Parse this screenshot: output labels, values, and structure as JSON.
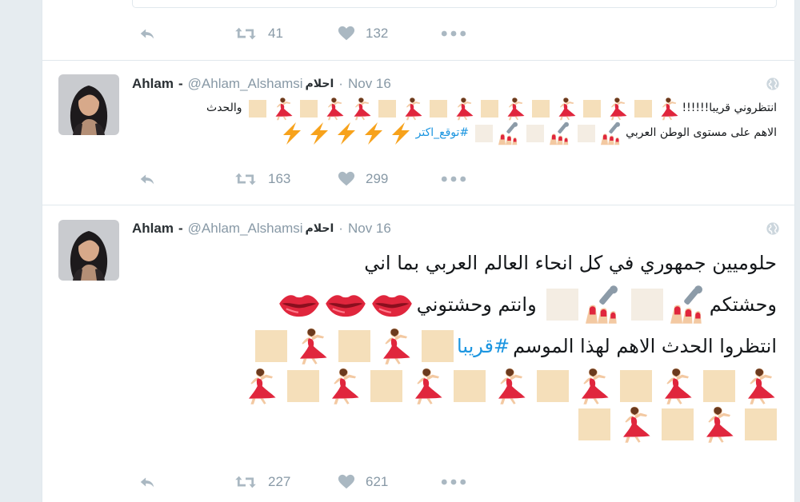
{
  "colors": {
    "accent": "#1b95e0",
    "muted": "#8899a6",
    "icon": "#aab8c2",
    "border": "#e1e8ed",
    "dancer": "#e0263d",
    "bolt": "#f7a21b",
    "square": "#f5dfba"
  },
  "top_actions": {
    "retweets": "41",
    "likes": "132"
  },
  "tweets": [
    {
      "name": "Ahlam",
      "sep": "-",
      "handle": "@Ahlam_Alshamsi",
      "arabic_name": "احلام",
      "dot": "·",
      "time": "Nov 16",
      "line1_text": "انتظروني قريبا!!!!!!",
      "line1_end": "والحدث",
      "line2_text": "الاهم على مستوى الوطن العربي",
      "hashtag": "#توقع_اكتر",
      "retweets": "163",
      "likes": "299"
    },
    {
      "name": "Ahlam",
      "sep": "-",
      "handle": "@Ahlam_Alshamsi",
      "arabic_name": "احلام",
      "dot": "·",
      "time": "Nov 16",
      "line1_text": "حلوميين جمهوري في كل انحاء العالم العربي بما اني",
      "line2_text_a": "وحشتكم",
      "line2_text_b": "وانتم وحشتوني",
      "line3_text": "انتظروا الحدث الاهم لهذا الموسم",
      "hashtag": "#قريبا",
      "retweets": "227",
      "likes": "621"
    }
  ],
  "icons": [
    "reply-icon",
    "retweet-icon",
    "heart-icon",
    "more-icon",
    "globe-icon",
    "dancer-icon",
    "nail-polish-icon",
    "lips-icon",
    "lightning-icon"
  ]
}
